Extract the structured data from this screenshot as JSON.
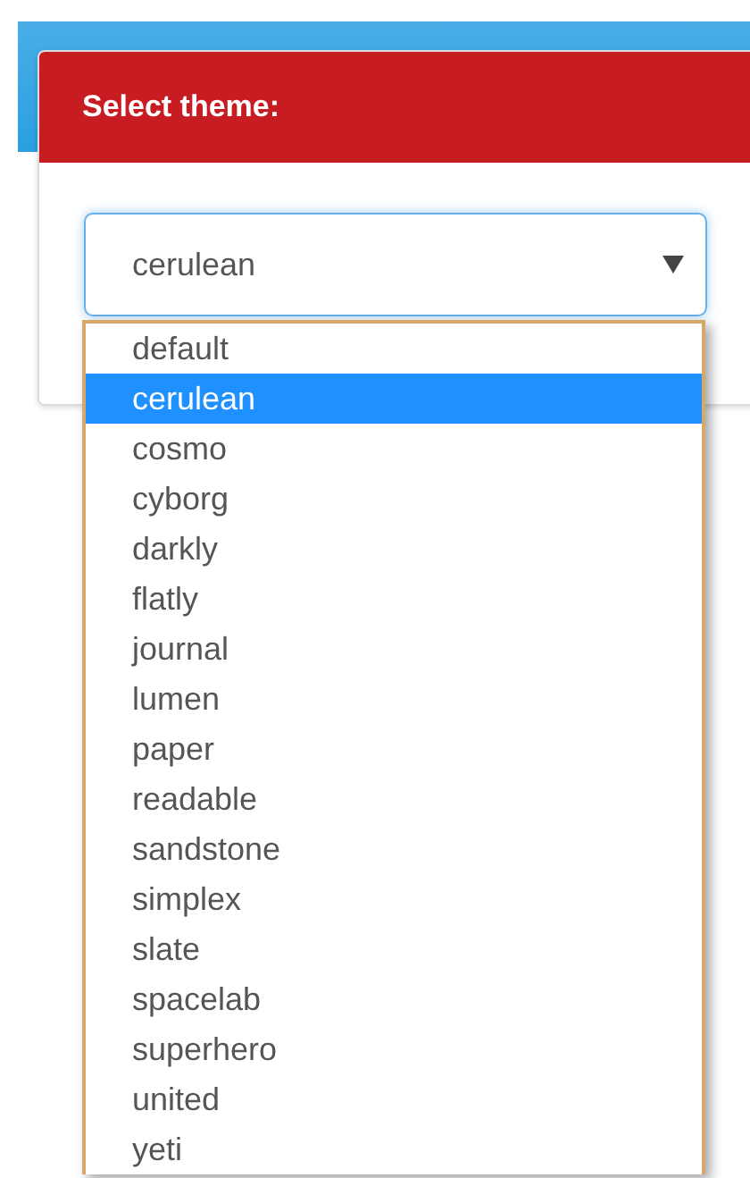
{
  "panel": {
    "title": "Select theme:"
  },
  "select": {
    "value": "cerulean"
  },
  "options": [
    {
      "label": "default",
      "selected": false
    },
    {
      "label": "cerulean",
      "selected": true
    },
    {
      "label": "cosmo",
      "selected": false
    },
    {
      "label": "cyborg",
      "selected": false
    },
    {
      "label": "darkly",
      "selected": false
    },
    {
      "label": "flatly",
      "selected": false
    },
    {
      "label": "journal",
      "selected": false
    },
    {
      "label": "lumen",
      "selected": false
    },
    {
      "label": "paper",
      "selected": false
    },
    {
      "label": "readable",
      "selected": false
    },
    {
      "label": "sandstone",
      "selected": false
    },
    {
      "label": "simplex",
      "selected": false
    },
    {
      "label": "slate",
      "selected": false
    },
    {
      "label": "spacelab",
      "selected": false
    },
    {
      "label": "superhero",
      "selected": false
    },
    {
      "label": "united",
      "selected": false
    },
    {
      "label": "yeti",
      "selected": false
    }
  ]
}
